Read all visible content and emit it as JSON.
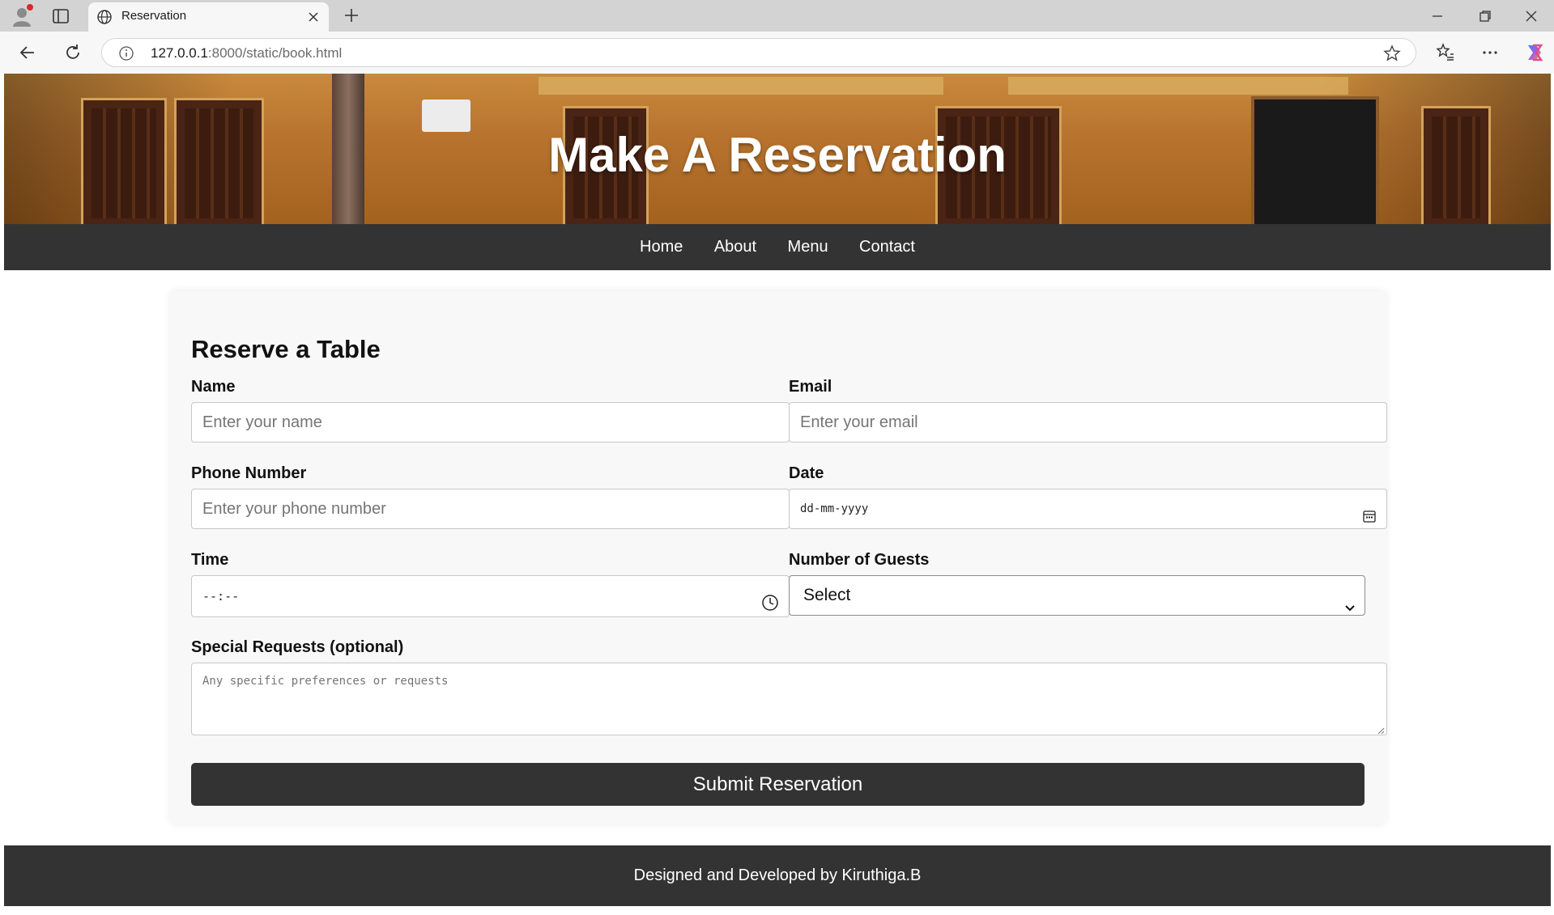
{
  "browser": {
    "tab_title": "Reservation",
    "url_host": "127.0.0.1",
    "url_path": ":8000/static/book.html"
  },
  "hero": {
    "title": "Make A Reservation"
  },
  "nav": {
    "items": [
      "Home",
      "About",
      "Menu",
      "Contact"
    ]
  },
  "form": {
    "heading": "Reserve a Table",
    "name": {
      "label": "Name",
      "placeholder": "Enter your name"
    },
    "email": {
      "label": "Email",
      "placeholder": "Enter your email"
    },
    "phone": {
      "label": "Phone Number",
      "placeholder": "Enter your phone number"
    },
    "date": {
      "label": "Date",
      "value": "dd-mm-yyyy"
    },
    "time": {
      "label": "Time",
      "value": "--:--"
    },
    "guests": {
      "label": "Number of Guests",
      "selected": "Select"
    },
    "requests": {
      "label": "Special Requests (optional)",
      "placeholder": "Any specific preferences or requests"
    },
    "submit_label": "Submit Reservation"
  },
  "footer": {
    "text": "Designed and Developed by Kiruthiga.B"
  },
  "colors": {
    "nav_bg": "#333333",
    "card_bg": "#f8f8f8",
    "button_bg": "#333333"
  },
  "icons": [
    "profile-icon",
    "tabs-icon",
    "globe-icon",
    "close-icon",
    "new-tab-icon",
    "minimize-icon",
    "restore-icon",
    "window-close-icon",
    "back-icon",
    "refresh-icon",
    "info-icon",
    "star-icon",
    "favorites-icon",
    "more-icon",
    "copilot-icon",
    "calendar-icon",
    "clock-icon",
    "chevron-down-icon"
  ]
}
